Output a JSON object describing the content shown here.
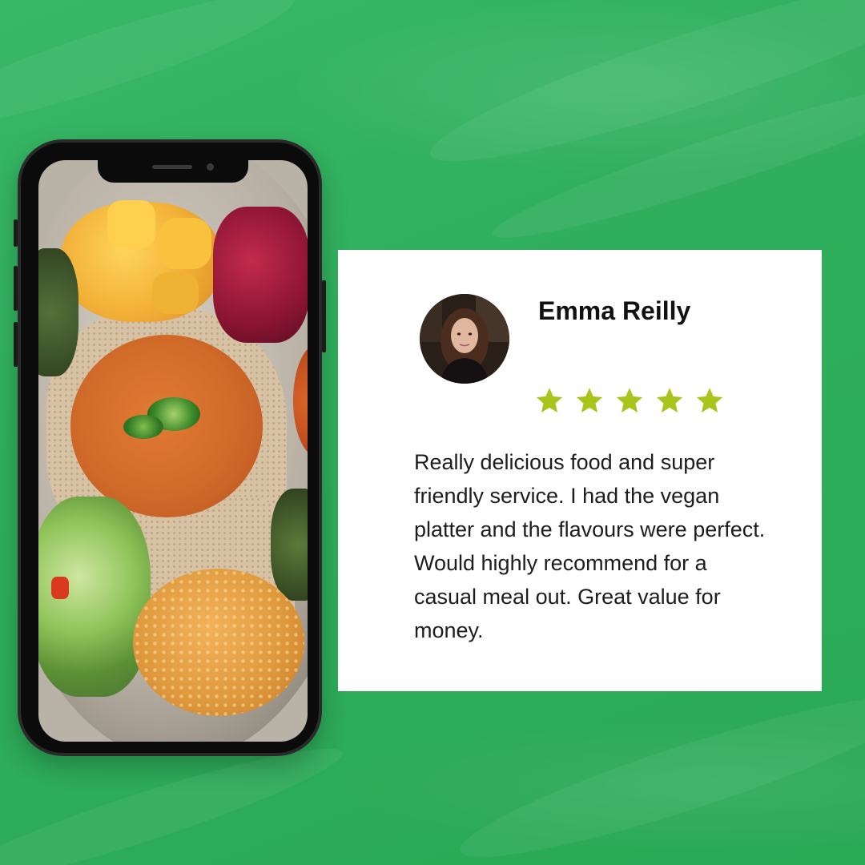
{
  "review": {
    "name": "Emma Reilly",
    "rating": 5,
    "max_rating": 5,
    "text": "Really delicious food and super friendly service. I had the vegan platter and the flavours were perfect. Would highly recommend for a casual meal out. Great value for money."
  },
  "colors": {
    "background": "#2fae5c",
    "star": "#a8c51c",
    "card": "#ffffff",
    "phone_frame": "#0b0b0b"
  },
  "icons": {
    "star": "star-icon"
  }
}
